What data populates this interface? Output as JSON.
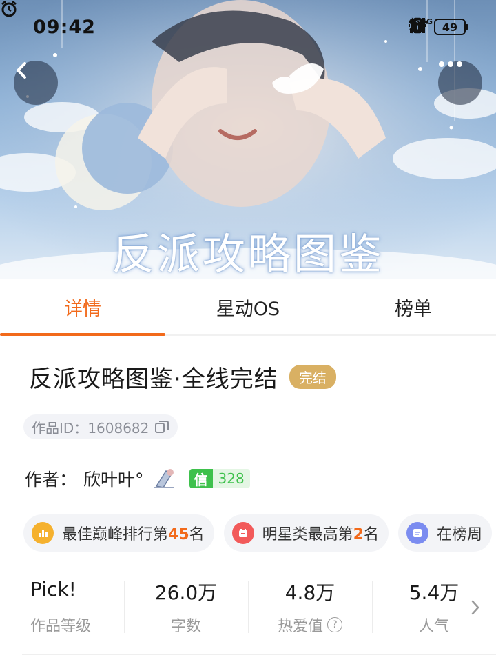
{
  "status_bar": {
    "time": "09:42",
    "network_tag_1": "4G",
    "network_tag_2": "5G",
    "battery": "49"
  },
  "cover": {
    "title_art": "反派攻略图鉴"
  },
  "tabs": [
    {
      "label": "详情",
      "active": true
    },
    {
      "label": "星动OS",
      "active": false
    },
    {
      "label": "榜单",
      "active": false
    }
  ],
  "work": {
    "title": "反派攻略图鉴·全线完结",
    "status_badge": "完结",
    "id_label": "作品ID：",
    "id_value": "1608682",
    "author_label": "作者：",
    "author_name": "欣叶叶°",
    "trust_key": "信",
    "trust_value": "328"
  },
  "chips": [
    {
      "prefix": "最佳巅峰排行第",
      "number": "45",
      "suffix": "名",
      "icon": "bar-chart-icon",
      "color": "#f5b12e"
    },
    {
      "prefix": "明星类最高第",
      "number": "2",
      "suffix": "名",
      "icon": "calendar-icon",
      "color": "#f25a5a"
    },
    {
      "prefix": "在榜周",
      "number": "",
      "suffix": "",
      "icon": "list-icon",
      "color": "#7b8cf0"
    }
  ],
  "stats": [
    {
      "value": "Pick!",
      "label": "作品等级"
    },
    {
      "value": "26.0万",
      "label": "字数"
    },
    {
      "value": "4.8万",
      "label": "热爱值"
    },
    {
      "value": "5.4万",
      "label": "人气"
    }
  ],
  "colors": {
    "accent": "#f26a1b",
    "badge_gold": "#d9b063",
    "trust_green": "#3ec14c"
  }
}
